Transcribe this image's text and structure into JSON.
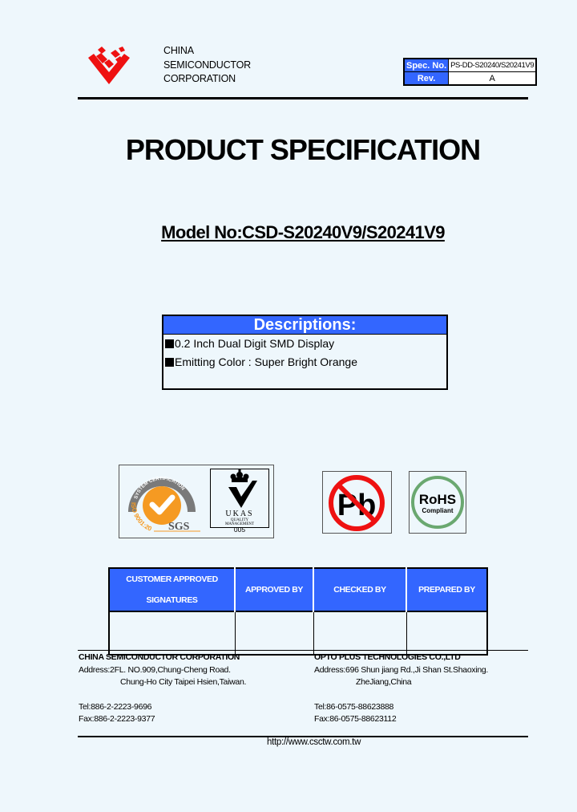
{
  "header": {
    "company_lines": [
      "CHINA",
      "SEMICONDUCTOR",
      "CORPORATION"
    ],
    "spec_label": "Spec. No.",
    "spec_value": "PS-DD-S20240/S20241V9",
    "rev_label": "Rev.",
    "rev_value": "A",
    "brand_color": "#ee1111",
    "accent_color": "#3366ff"
  },
  "title": "PRODUCT SPECIFICATION",
  "model": "Model No:CSD-S20240V9/S20241V9",
  "descriptions": {
    "heading": "Descriptions:",
    "items": [
      "0.2 Inch Dual Digit  SMD Display",
      "Emitting Color : Super Bright Orange"
    ]
  },
  "certifications": {
    "sgs": {
      "arc_text": "SYSTEM CERTIFICATION",
      "iso_text": "ISO 9001:2000",
      "brand": "SGS"
    },
    "ukas": {
      "name": "UKAS",
      "line1": "QUALITY",
      "line2": "MANAGEMENT",
      "code": "005"
    },
    "pb": {
      "symbol": "Pb"
    },
    "rohs": {
      "title": "RoHS",
      "subtitle": "Compliant"
    }
  },
  "signatures": {
    "headers": [
      [
        "CUSTOMER APPROVED",
        "SIGNATURES"
      ],
      [
        "APPROVED BY"
      ],
      [
        "CHECKED BY"
      ],
      [
        "PREPARED BY"
      ]
    ]
  },
  "footer": {
    "left": {
      "company": "CHINA SEMICONDUCTOR CORPORATION",
      "address1": "Address:2FL. NO.909,Chung-Cheng Road.",
      "address2": "Chung-Ho City Taipei Hsien,Taiwan.",
      "tel": "Tel:886-2-2223-9696",
      "fax": "Fax:886-2-2223-9377"
    },
    "right": {
      "company": "OPTO PLUS TECHNOLOGIES CO.,LTD",
      "address1": "Address:696 Shun jiang Rd.,Ji Shan St.Shaoxing.",
      "address2": "ZheJiang,China",
      "tel": "Tel:86-0575-88623888",
      "fax": "Fax:86-0575-88623112"
    },
    "url": "http://www.csctw.com.tw"
  }
}
